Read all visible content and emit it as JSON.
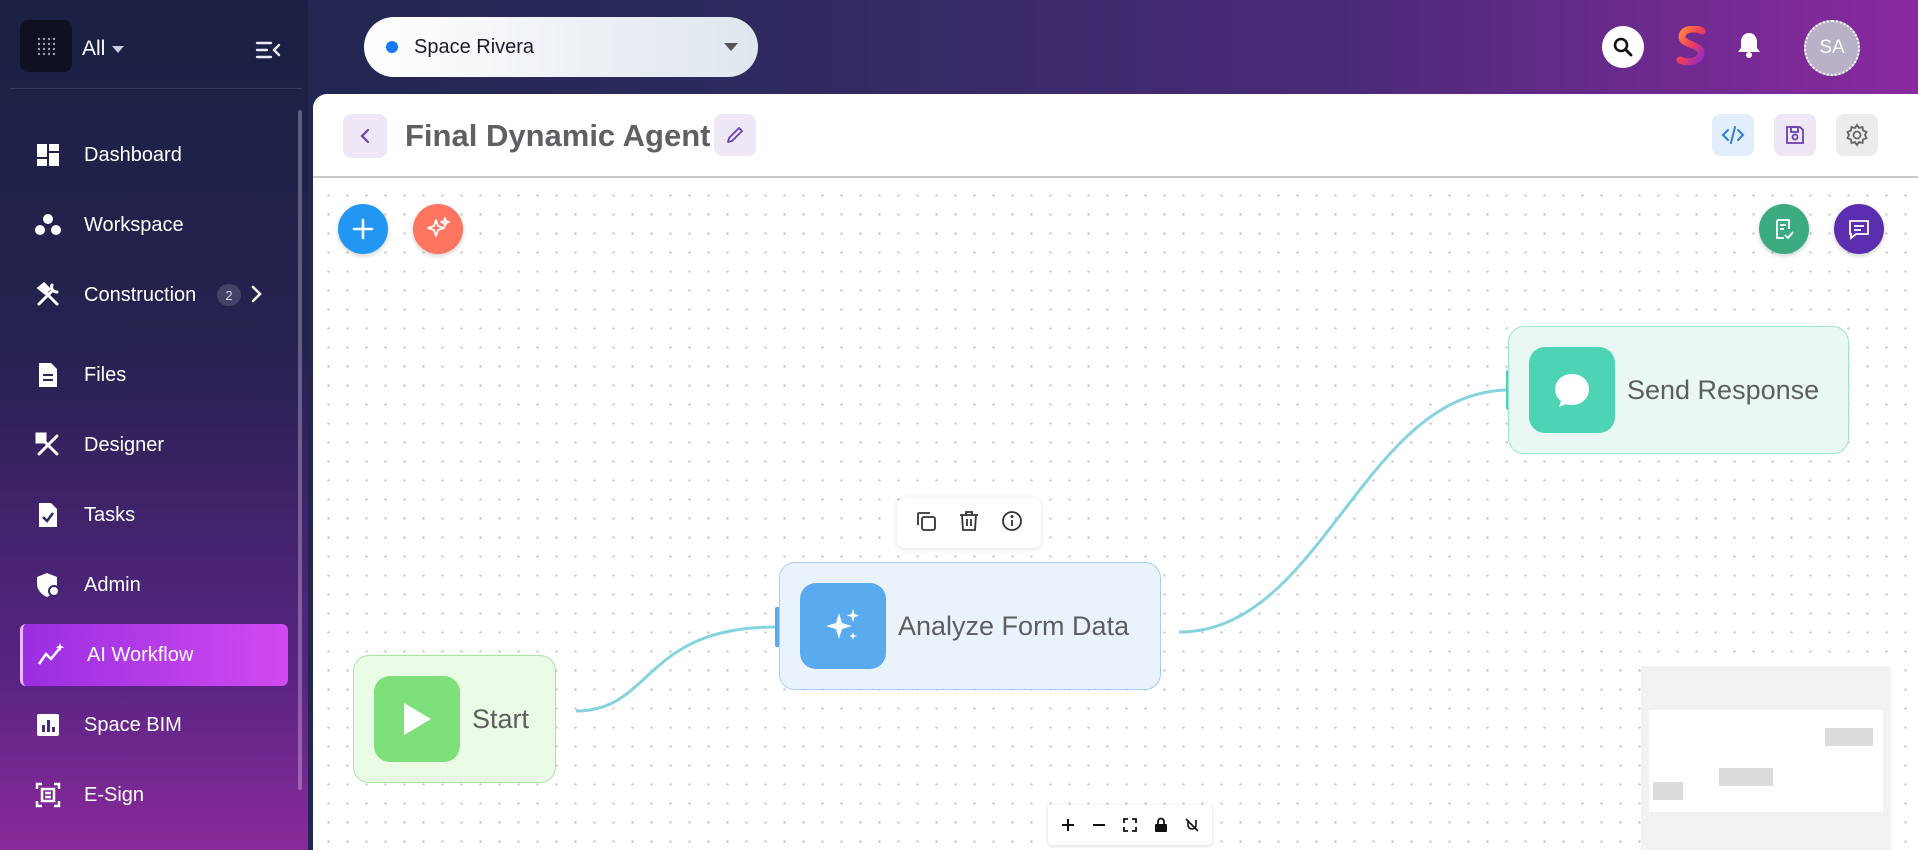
{
  "sidebar": {
    "scope_label": "All",
    "items": [
      {
        "label": "Dashboard",
        "icon": "dashboard-icon"
      },
      {
        "label": "Workspace",
        "icon": "workspace-icon"
      },
      {
        "label": "Construction",
        "icon": "construction-icon",
        "badge": "2"
      },
      {
        "label": "Files",
        "icon": "file-icon"
      },
      {
        "label": "Designer",
        "icon": "designer-icon"
      },
      {
        "label": "Tasks",
        "icon": "tasks-icon"
      },
      {
        "label": "Admin",
        "icon": "admin-icon"
      },
      {
        "label": "AI Workflow",
        "icon": "ai-workflow-icon",
        "active": true
      },
      {
        "label": "Space BIM",
        "icon": "chart-icon"
      },
      {
        "label": "E-Sign",
        "icon": "esign-icon"
      }
    ]
  },
  "topbar": {
    "space_name": "Space Rivera",
    "avatar_initials": "SA"
  },
  "editor": {
    "title": "Final Dynamic Agent"
  },
  "workflow": {
    "nodes": [
      {
        "label": "Start",
        "type": "start"
      },
      {
        "label": "Analyze Form Data",
        "type": "ai"
      },
      {
        "label": "Send Response",
        "type": "message"
      }
    ],
    "edges": [
      {
        "from": "Start",
        "to": "Analyze Form Data"
      },
      {
        "from": "Analyze Form Data",
        "to": "Send Response"
      }
    ]
  },
  "colors": {
    "accent": "#9a2ee0",
    "start_node": "#7ee07a",
    "ai_node": "#5aaaf0",
    "message_node": "#4dd4b4",
    "edge": "#86d3e0"
  }
}
